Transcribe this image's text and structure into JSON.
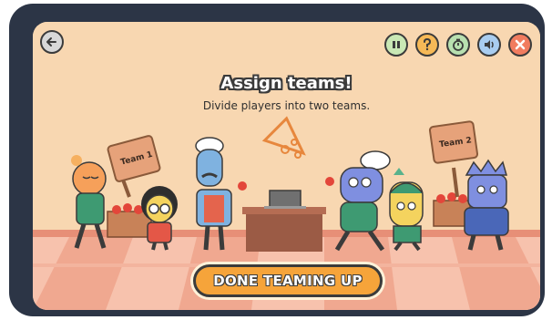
{
  "header": {
    "back_icon": "arrow-left-icon",
    "controls": [
      {
        "name": "pause-button",
        "icon": "pause-icon",
        "color": "#c9e8b5"
      },
      {
        "name": "help-button",
        "icon": "question-icon",
        "color": "#f6b957"
      },
      {
        "name": "timer-button",
        "icon": "stopwatch-icon",
        "color": "#b8e0b0"
      },
      {
        "name": "sound-button",
        "icon": "speaker-icon",
        "color": "#a9cdf0"
      },
      {
        "name": "close-button",
        "icon": "close-icon",
        "color": "#f17c5f"
      }
    ]
  },
  "main": {
    "title": "Assign teams!",
    "subtitle": "Divide players into two teams."
  },
  "signs": {
    "team1": "Team 1",
    "team2": "Team 2"
  },
  "done_button": {
    "label": "DONE TEAMING UP"
  },
  "colors": {
    "background": "#f8d7b1",
    "frame": "#2c3546",
    "button_accent": "#f6a43a",
    "floor_light": "#f7c2ad",
    "floor_dark": "#f0a890"
  }
}
